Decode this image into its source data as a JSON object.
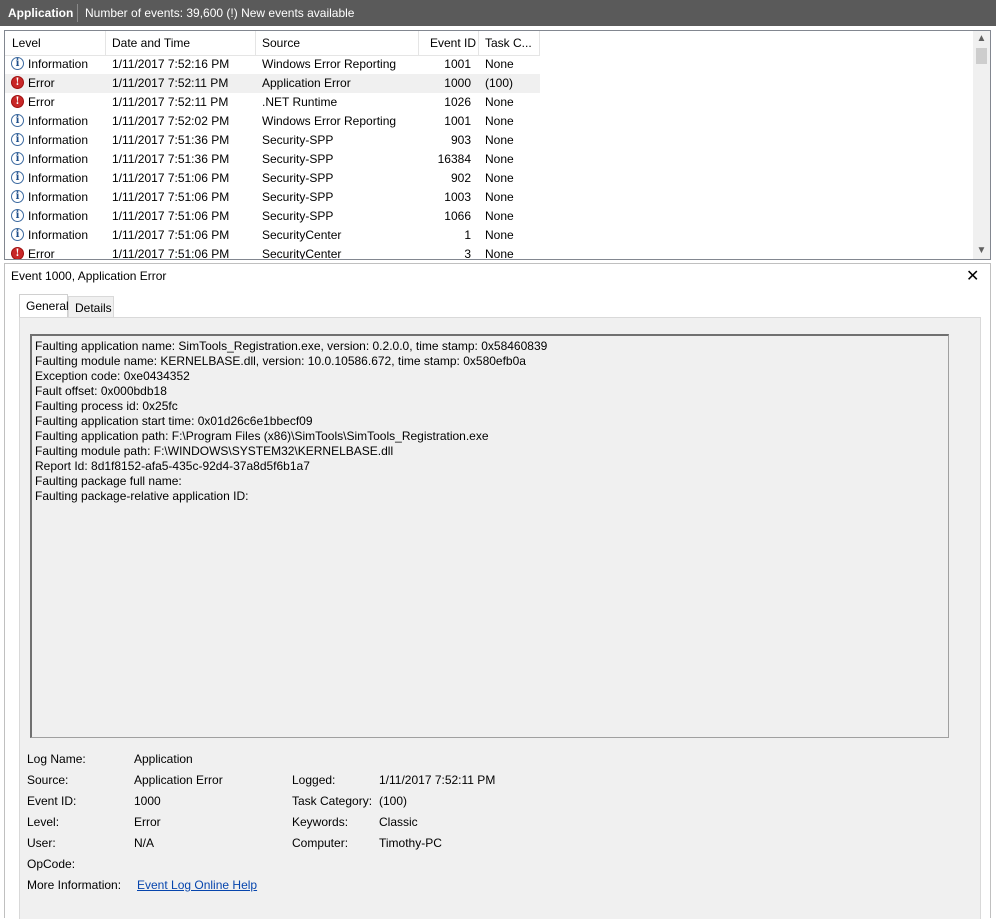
{
  "titlebar": {
    "app_name": "Application",
    "event_count": "Number of events: 39,600 (!) New events available"
  },
  "columns": [
    "Level",
    "Date and Time",
    "Source",
    "Event ID",
    "Task C..."
  ],
  "rows": [
    {
      "icon": "info-icon",
      "level": "Information",
      "datetime": "1/11/2017 7:52:16 PM",
      "source": "Windows Error Reporting",
      "event_id": "1001",
      "task": "None"
    },
    {
      "icon": "error-icon",
      "level": "Error",
      "datetime": "1/11/2017 7:52:11 PM",
      "source": "Application Error",
      "event_id": "1000",
      "task": "(100)"
    },
    {
      "icon": "error-icon",
      "level": "Error",
      "datetime": "1/11/2017 7:52:11 PM",
      "source": ".NET Runtime",
      "event_id": "1026",
      "task": "None"
    },
    {
      "icon": "info-icon",
      "level": "Information",
      "datetime": "1/11/2017 7:52:02 PM",
      "source": "Windows Error Reporting",
      "event_id": "1001",
      "task": "None"
    },
    {
      "icon": "info-icon",
      "level": "Information",
      "datetime": "1/11/2017 7:51:36 PM",
      "source": "Security-SPP",
      "event_id": "903",
      "task": "None"
    },
    {
      "icon": "info-icon",
      "level": "Information",
      "datetime": "1/11/2017 7:51:36 PM",
      "source": "Security-SPP",
      "event_id": "16384",
      "task": "None"
    },
    {
      "icon": "info-icon",
      "level": "Information",
      "datetime": "1/11/2017 7:51:06 PM",
      "source": "Security-SPP",
      "event_id": "902",
      "task": "None"
    },
    {
      "icon": "info-icon",
      "level": "Information",
      "datetime": "1/11/2017 7:51:06 PM",
      "source": "Security-SPP",
      "event_id": "1003",
      "task": "None"
    },
    {
      "icon": "info-icon",
      "level": "Information",
      "datetime": "1/11/2017 7:51:06 PM",
      "source": "Security-SPP",
      "event_id": "1066",
      "task": "None"
    },
    {
      "icon": "info-icon",
      "level": "Information",
      "datetime": "1/11/2017 7:51:06 PM",
      "source": "SecurityCenter",
      "event_id": "1",
      "task": "None"
    },
    {
      "icon": "error-icon",
      "level": "Error",
      "datetime": "1/11/2017 7:51:06 PM",
      "source": "SecurityCenter",
      "event_id": "3",
      "task": "None"
    }
  ],
  "detail": {
    "title": "Event 1000, Application Error",
    "close_glyph": "✕",
    "tabs": [
      "General",
      "Details"
    ],
    "description": [
      "Faulting application name: SimTools_Registration.exe, version: 0.2.0.0, time stamp: 0x58460839",
      "Faulting module name: KERNELBASE.dll, version: 10.0.10586.672, time stamp: 0x580efb0a",
      "Exception code: 0xe0434352",
      "Fault offset: 0x000bdb18",
      "Faulting process id: 0x25fc",
      "Faulting application start time: 0x01d26c6e1bbecf09",
      "Faulting application path: F:\\Program Files (x86)\\SimTools\\SimTools_Registration.exe",
      "Faulting module path: F:\\WINDOWS\\SYSTEM32\\KERNELBASE.dll",
      "Report Id: 8d1f8152-afa5-435c-92d4-37a8d5f6b1a7",
      "Faulting package full name:",
      "Faulting package-relative application ID:"
    ],
    "fields": {
      "log_name_label": "Log Name:",
      "log_name": "Application",
      "source_label": "Source:",
      "source": "Application Error",
      "logged_label": "Logged:",
      "logged": "1/11/2017 7:52:11 PM",
      "event_id_label": "Event ID:",
      "event_id": "1000",
      "task_category_label": "Task Category:",
      "task_category": "(100)",
      "level_label": "Level:",
      "level": "Error",
      "keywords_label": "Keywords:",
      "keywords": "Classic",
      "user_label": "User:",
      "user": "N/A",
      "computer_label": "Computer:",
      "computer": "Timothy-PC",
      "opcode_label": "OpCode:",
      "opcode": "",
      "more_info_label": "More Information:",
      "more_info_link": "Event Log Online Help"
    }
  },
  "scrollbar": {
    "up_arrow": "▲",
    "down_arrow": "▼"
  },
  "colors": {
    "titlebar": "#5a5a5a",
    "error": "#c82828",
    "info": "#1f4f8b",
    "link": "#0645ad"
  }
}
